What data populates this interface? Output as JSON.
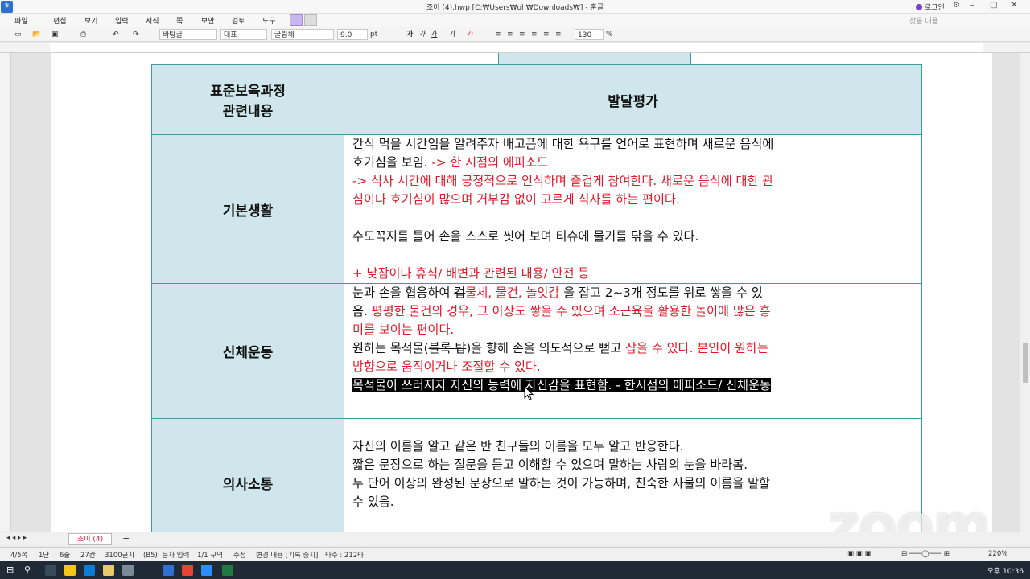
{
  "window": {
    "title": "조이 (4).hwp [C:₩Users₩oh₩Downloads₩] - 훈글",
    "login_label": "로그인",
    "controls": [
      "⚙",
      "–",
      "□",
      "✕"
    ]
  },
  "menu": {
    "items": [
      "파일",
      "편집",
      "보기",
      "입력",
      "서식",
      "쪽",
      "보안",
      "검토",
      "도구"
    ],
    "search_placeholder": "찾을 내용"
  },
  "toolbar": {
    "style": "바탕글",
    "style2": "대표",
    "font": "굴림체",
    "size": "9.0",
    "size_unit": "pt",
    "zoom": "130",
    "zoom_unit": "%"
  },
  "table": {
    "header_left": [
      "표준보육과정",
      "관련내용"
    ],
    "header_right": "발달평가",
    "rows": [
      {
        "category": "기본생활",
        "lines": [
          [
            {
              "t": "간식 먹을 시간임을 알려주자 배고픔에 대한 욕구를 언어로 표현하며 새로운 음식에"
            }
          ],
          [
            {
              "t": "호기심을 보임. "
            },
            {
              "t": "-> 한 시점의 에피소드",
              "c": "red"
            }
          ],
          [
            {
              "t": "-> 식사 시간에 대해 긍정적으로 인식하며 즐겁게 참여한다. 새로운 음식에 대한 관",
              "c": "red"
            }
          ],
          [
            {
              "t": "심이나 호기심이 많으며 거부감 없이 고르게 식사를 하는 편이다.",
              "c": "red"
            }
          ],
          [
            {
              "t": ""
            }
          ],
          [
            {
              "t": "수도꼭지를 틀어 손을 스스로 씻어 보며 티슈에 물기를 닦을 수 있다."
            }
          ],
          [
            {
              "t": ""
            }
          ],
          [
            {
              "t": "+ 낮잠이나 휴식/ 배변과 관련된 내용/ 안전 등",
              "c": "red"
            }
          ]
        ]
      },
      {
        "category": "신체운동",
        "lines": [
          [
            {
              "t": "눈과 손을 협응하여 "
            },
            {
              "t": "컵",
              "c": "strike"
            },
            {
              "t": "물체, 물건, 놀잇감",
              "c": "red"
            },
            {
              "t": " 을 잡고 2~3개 정도를 위로 쌓을 수 있"
            }
          ],
          [
            {
              "t": "음. "
            },
            {
              "t": "평평한 물건의 경우, 그 이상도 쌓을 수 있으며 소근육을 활용한 놀이에 많은 흥",
              "c": "red"
            }
          ],
          [
            {
              "t": "미를 보이는 편이다.",
              "c": "red"
            }
          ],
          [
            {
              "t": "원하는 목적물("
            },
            {
              "t": "블록 탑",
              "c": "strike"
            },
            {
              "t": ")을 향해 손을 의도적으로 뻗고 "
            },
            {
              "t": "잡을 수 있다. 본인이 원하는",
              "c": "red"
            }
          ],
          [
            {
              "t": "방향으로 움직이거나 조절할 수 있다.",
              "c": "red"
            }
          ],
          [
            {
              "t": "목적물이 쓰러지자 자신의 능력에 자신감을 표현함. - 한시점의 에피소드/ 신체운동",
              "c": "sel"
            }
          ],
          [
            {
              "t": " ",
              "c": "sel"
            }
          ]
        ]
      },
      {
        "category": "의사소통",
        "lines": [
          [
            {
              "t": ""
            }
          ],
          [
            {
              "t": "자신의 이름을 알고 같은 반 친구들의 이름을 모두 알고 반응한다."
            }
          ],
          [
            {
              "t": "짧은 문장으로 하는 질문을 듣고 이해할 수 있으며 말하는 사람의 눈을 바라봄."
            }
          ],
          [
            {
              "t": "두 단어 이상의 완성된 문장으로 말하는 것이 가능하며, 친숙한 사물의 이름을 말할"
            }
          ],
          [
            {
              "t": "수 있음."
            }
          ]
        ]
      }
    ]
  },
  "tabs": {
    "doc_tab": "조이 (4)",
    "add": "+"
  },
  "status": {
    "items": [
      "4/5쪽",
      "1단",
      "6줄",
      "27칸",
      "3100글자",
      "(B5): 문자 입력",
      "1/1 구역",
      "수정",
      "변경 내용 [기록 중지]",
      "타수 : 212타"
    ],
    "zoom": "220%"
  },
  "overlay": {
    "zoom_logo": "zoom"
  },
  "taskbar": {
    "clock": "오후 10:36"
  }
}
